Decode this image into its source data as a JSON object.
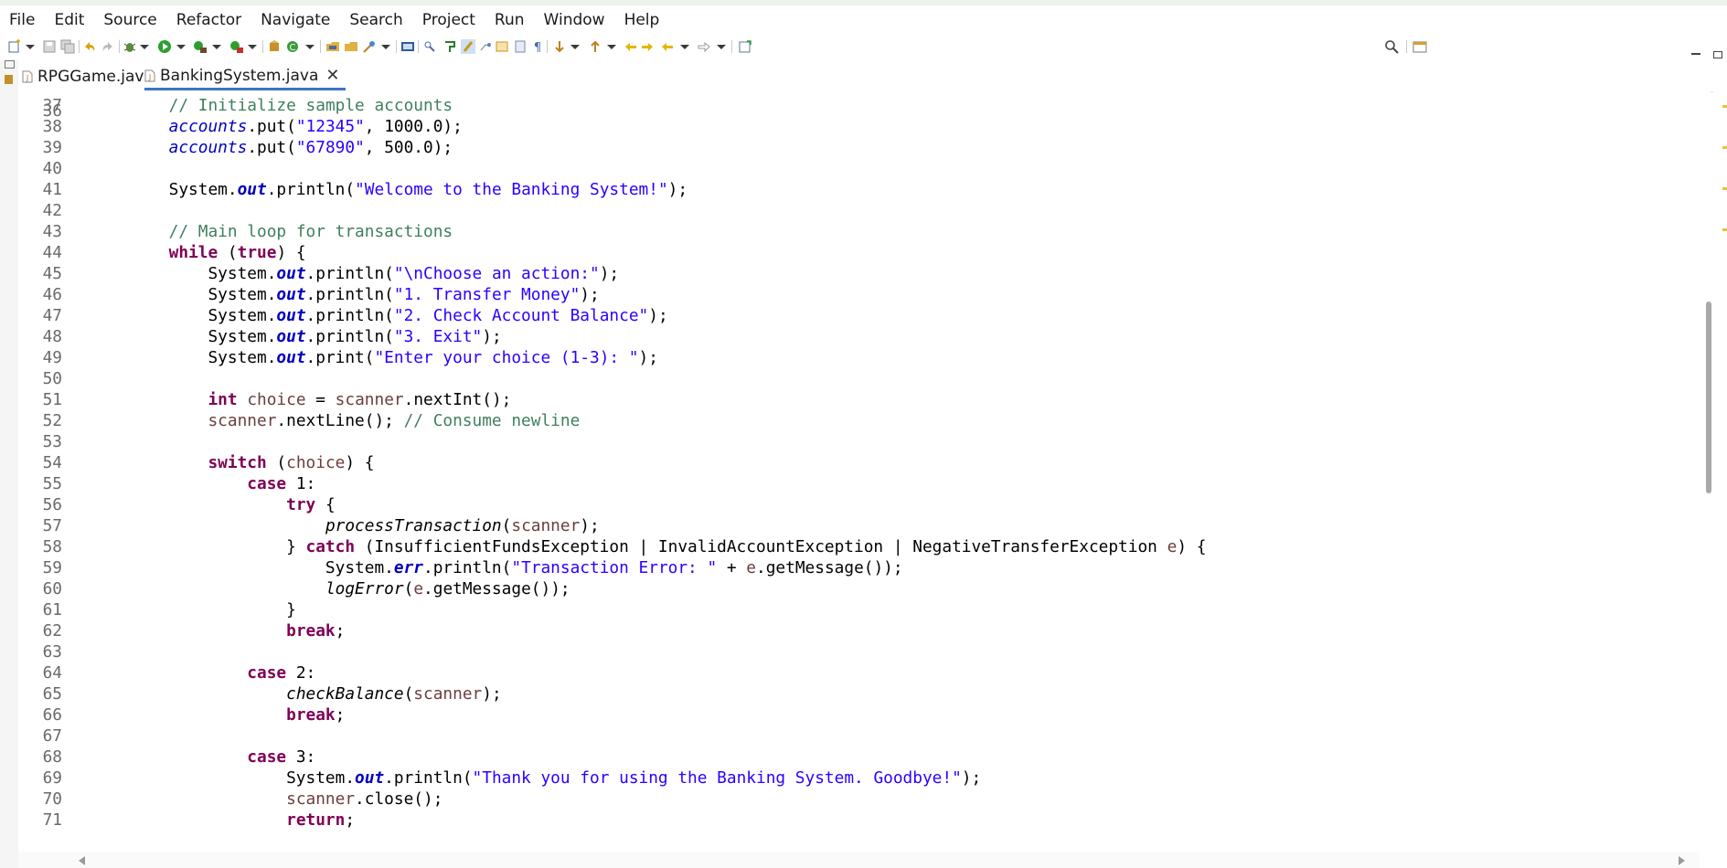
{
  "menu": [
    "File",
    "Edit",
    "Source",
    "Refactor",
    "Navigate",
    "Search",
    "Project",
    "Run",
    "Window",
    "Help"
  ],
  "tabs": [
    {
      "label": "RPGGame.java",
      "active": false
    },
    {
      "label": "BankingSystem.java",
      "active": true,
      "close": "✕"
    }
  ],
  "editor": {
    "lines": [
      {
        "n": "37",
        "segs": [
          [
            "        ",
            ""
          ],
          [
            "// Initialize sample accounts",
            "c"
          ]
        ]
      },
      {
        "n": "38",
        "segs": [
          [
            "        ",
            ""
          ],
          [
            "accounts",
            "f"
          ],
          [
            ".put(",
            ""
          ],
          [
            "\"12345\"",
            "s"
          ],
          [
            ", 1000.0);",
            ""
          ]
        ]
      },
      {
        "n": "39",
        "segs": [
          [
            "        ",
            ""
          ],
          [
            "accounts",
            "f"
          ],
          [
            ".put(",
            ""
          ],
          [
            "\"67890\"",
            "s"
          ],
          [
            ", 500.0);",
            ""
          ]
        ]
      },
      {
        "n": "40",
        "segs": []
      },
      {
        "n": "41",
        "segs": [
          [
            "        System.",
            ""
          ],
          [
            "out",
            "fb"
          ],
          [
            ".println(",
            ""
          ],
          [
            "\"Welcome to the Banking System!\"",
            "s"
          ],
          [
            ");",
            ""
          ]
        ]
      },
      {
        "n": "42",
        "segs": []
      },
      {
        "n": "43",
        "segs": [
          [
            "        ",
            ""
          ],
          [
            "// Main loop for transactions",
            "c"
          ]
        ]
      },
      {
        "n": "44",
        "segs": [
          [
            "        ",
            ""
          ],
          [
            "while",
            "k"
          ],
          [
            " (",
            ""
          ],
          [
            "true",
            "k"
          ],
          [
            ") {",
            ""
          ]
        ]
      },
      {
        "n": "45",
        "segs": [
          [
            "            System.",
            ""
          ],
          [
            "out",
            "fb"
          ],
          [
            ".println(",
            ""
          ],
          [
            "\"\\nChoose an action:\"",
            "s"
          ],
          [
            ");",
            ""
          ]
        ]
      },
      {
        "n": "46",
        "segs": [
          [
            "            System.",
            ""
          ],
          [
            "out",
            "fb"
          ],
          [
            ".println(",
            ""
          ],
          [
            "\"1. Transfer Money\"",
            "s"
          ],
          [
            ");",
            ""
          ]
        ]
      },
      {
        "n": "47",
        "segs": [
          [
            "            System.",
            ""
          ],
          [
            "out",
            "fb"
          ],
          [
            ".println(",
            ""
          ],
          [
            "\"2. Check Account Balance\"",
            "s"
          ],
          [
            ");",
            ""
          ]
        ]
      },
      {
        "n": "48",
        "segs": [
          [
            "            System.",
            ""
          ],
          [
            "out",
            "fb"
          ],
          [
            ".println(",
            ""
          ],
          [
            "\"3. Exit\"",
            "s"
          ],
          [
            ");",
            ""
          ]
        ]
      },
      {
        "n": "49",
        "segs": [
          [
            "            System.",
            ""
          ],
          [
            "out",
            "fb"
          ],
          [
            ".print(",
            ""
          ],
          [
            "\"Enter your choice (1-3): \"",
            "s"
          ],
          [
            ");",
            ""
          ]
        ]
      },
      {
        "n": "50",
        "segs": []
      },
      {
        "n": "51",
        "segs": [
          [
            "            ",
            ""
          ],
          [
            "int",
            "k"
          ],
          [
            " ",
            ""
          ],
          [
            "choice",
            "vr"
          ],
          [
            " = ",
            ""
          ],
          [
            "scanner",
            "vr"
          ],
          [
            ".nextInt();",
            ""
          ]
        ]
      },
      {
        "n": "52",
        "segs": [
          [
            "            ",
            ""
          ],
          [
            "scanner",
            "vr"
          ],
          [
            ".nextLine(); ",
            ""
          ],
          [
            "// Consume newline",
            "c"
          ]
        ]
      },
      {
        "n": "53",
        "segs": []
      },
      {
        "n": "54",
        "segs": [
          [
            "            ",
            ""
          ],
          [
            "switch",
            "k"
          ],
          [
            " (",
            ""
          ],
          [
            "choice",
            "vr"
          ],
          [
            ") {",
            ""
          ]
        ]
      },
      {
        "n": "55",
        "segs": [
          [
            "                ",
            ""
          ],
          [
            "case",
            "k"
          ],
          [
            " 1:",
            ""
          ]
        ]
      },
      {
        "n": "56",
        "segs": [
          [
            "                    ",
            ""
          ],
          [
            "try",
            "k"
          ],
          [
            " {",
            ""
          ]
        ]
      },
      {
        "n": "57",
        "segs": [
          [
            "                        ",
            ""
          ],
          [
            "processTransaction",
            "sm"
          ],
          [
            "(",
            ""
          ],
          [
            "scanner",
            "vr"
          ],
          [
            ");",
            ""
          ]
        ]
      },
      {
        "n": "58",
        "segs": [
          [
            "                    } ",
            ""
          ],
          [
            "catch",
            "k"
          ],
          [
            " (InsufficientFundsException | InvalidAccountException | NegativeTransferException ",
            ""
          ],
          [
            "e",
            "vr"
          ],
          [
            ") {",
            ""
          ]
        ]
      },
      {
        "n": "59",
        "segs": [
          [
            "                        System.",
            ""
          ],
          [
            "err",
            "fb"
          ],
          [
            ".println(",
            ""
          ],
          [
            "\"Transaction Error: \"",
            "s"
          ],
          [
            " + ",
            ""
          ],
          [
            "e",
            "vr"
          ],
          [
            ".getMessage());",
            ""
          ]
        ]
      },
      {
        "n": "60",
        "segs": [
          [
            "                        ",
            ""
          ],
          [
            "logError",
            "sm"
          ],
          [
            "(",
            ""
          ],
          [
            "e",
            "vr"
          ],
          [
            ".getMessage());",
            ""
          ]
        ]
      },
      {
        "n": "61",
        "segs": [
          [
            "                    }",
            ""
          ]
        ]
      },
      {
        "n": "62",
        "segs": [
          [
            "                    ",
            ""
          ],
          [
            "break",
            "k"
          ],
          [
            ";",
            ""
          ]
        ]
      },
      {
        "n": "63",
        "segs": []
      },
      {
        "n": "64",
        "segs": [
          [
            "                ",
            ""
          ],
          [
            "case",
            "k"
          ],
          [
            " 2:",
            ""
          ]
        ]
      },
      {
        "n": "65",
        "segs": [
          [
            "                    ",
            ""
          ],
          [
            "checkBalance",
            "sm"
          ],
          [
            "(",
            ""
          ],
          [
            "scanner",
            "vr"
          ],
          [
            ");",
            ""
          ]
        ]
      },
      {
        "n": "66",
        "segs": [
          [
            "                    ",
            ""
          ],
          [
            "break",
            "k"
          ],
          [
            ";",
            ""
          ]
        ]
      },
      {
        "n": "67",
        "segs": []
      },
      {
        "n": "68",
        "segs": [
          [
            "                ",
            ""
          ],
          [
            "case",
            "k"
          ],
          [
            " 3:",
            ""
          ]
        ]
      },
      {
        "n": "69",
        "segs": [
          [
            "                    System.",
            ""
          ],
          [
            "out",
            "fb"
          ],
          [
            ".println(",
            ""
          ],
          [
            "\"Thank you for using the Banking System. Goodbye!\"",
            "s"
          ],
          [
            ");",
            ""
          ]
        ]
      },
      {
        "n": "70",
        "segs": [
          [
            "                    ",
            ""
          ],
          [
            "scanner",
            "vr"
          ],
          [
            ".close();",
            ""
          ]
        ]
      },
      {
        "n": "71",
        "segs": [
          [
            "                    ",
            ""
          ],
          [
            "return",
            "k"
          ],
          [
            ";",
            ""
          ]
        ]
      }
    ]
  },
  "colors": {
    "keyword": "#7f0055",
    "string": "#2a00ff",
    "comment": "#3f7f5f",
    "field": "#0000c0",
    "tab_active_underline": "#3d73c8"
  },
  "toolbar_icons": [
    "new-icon",
    "save-icon",
    "save-all-icon",
    "undo-icon",
    "redo-icon",
    "debug-icon",
    "run-icon",
    "coverage-icon",
    "external-tools-icon",
    "new-package-icon",
    "new-class-icon",
    "open-type-icon",
    "open-folder-icon",
    "search-icon-tb",
    "terminal-icon",
    "toggle-breakpoint-icon",
    "mark-occurrences-icon",
    "highlight-icon",
    "show-whitespace-icon",
    "next-annotation-icon",
    "previous-annotation-icon",
    "back-icon",
    "forward-icon",
    "pin-editor-icon",
    "search-icon",
    "perspective-icon"
  ]
}
